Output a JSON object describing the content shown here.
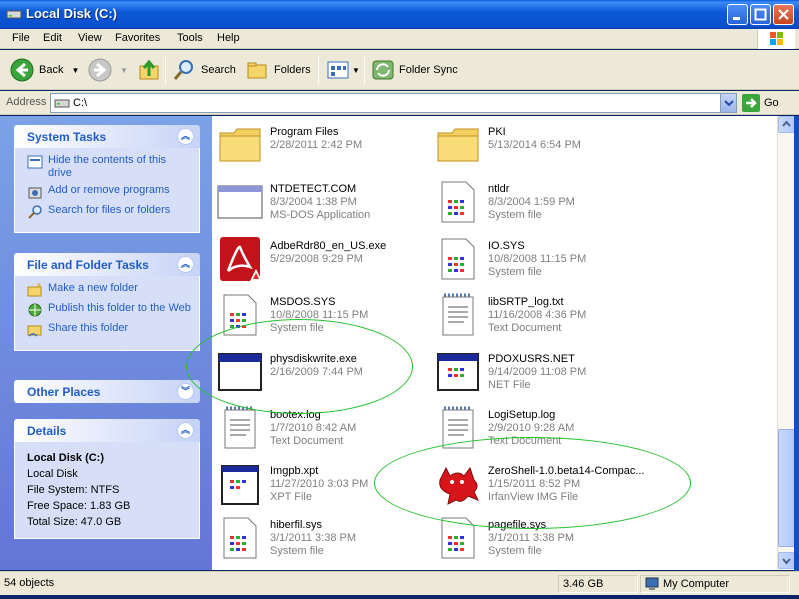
{
  "window": {
    "title": "Local Disk (C:)"
  },
  "menu": [
    "File",
    "Edit",
    "View",
    "Favorites",
    "Tools",
    "Help"
  ],
  "toolbar": {
    "back": "Back",
    "search": "Search",
    "folders": "Folders",
    "folder_sync": "Folder Sync"
  },
  "address": {
    "label": "Address",
    "value": "C:\\",
    "go": "Go"
  },
  "system_tasks": {
    "title": "System Tasks",
    "items": [
      "Hide the contents of this drive",
      "Add or remove programs",
      "Search for files or folders"
    ]
  },
  "file_folder_tasks": {
    "title": "File and Folder Tasks",
    "items": [
      "Make a new folder",
      "Publish this folder to the Web",
      "Share this folder"
    ]
  },
  "other_places": {
    "title": "Other Places"
  },
  "details": {
    "title": "Details",
    "name": "Local Disk (C:)",
    "type": "Local Disk",
    "filesystem": "File System: NTFS",
    "free": "Free Space: 1.83 GB",
    "total": "Total Size: 47.0 GB"
  },
  "files": [
    {
      "name": "Program Files",
      "line2": "2/28/2011 2:42 PM",
      "line3": "",
      "icon": "folder-icon"
    },
    {
      "name": "PKI",
      "line2": "5/13/2014 6:54 PM",
      "line3": "",
      "icon": "folder-icon"
    },
    {
      "name": "NTDETECT.COM",
      "line2": "8/3/2004 1:38 PM",
      "line3": "MS-DOS Application",
      "icon": "app-window-icon"
    },
    {
      "name": "ntldr",
      "line2": "8/3/2004 1:59 PM",
      "line3": "System file",
      "icon": "system-file-icon"
    },
    {
      "name": "AdbeRdr80_en_US.exe",
      "line2": "5/29/2008 9:29 PM",
      "line3": "",
      "icon": "adobe-reader-icon"
    },
    {
      "name": "IO.SYS",
      "line2": "10/8/2008 11:15 PM",
      "line3": "System file",
      "icon": "system-file-icon"
    },
    {
      "name": "MSDOS.SYS",
      "line2": "10/8/2008 11:15 PM",
      "line3": "System file",
      "icon": "system-file-icon"
    },
    {
      "name": "libSRTP_log.txt",
      "line2": "11/16/2008 4:36 PM",
      "line3": "Text Document",
      "icon": "text-document-icon"
    },
    {
      "name": "physdiskwrite.exe",
      "line2": "2/16/2009 7:44 PM",
      "line3": "",
      "icon": "exe-window-icon"
    },
    {
      "name": "PDOXUSRS.NET",
      "line2": "9/14/2009 11:08 PM",
      "line3": "NET File",
      "icon": "net-file-icon"
    },
    {
      "name": "bootex.log",
      "line2": "1/7/2010 8:42 AM",
      "line3": "Text Document",
      "icon": "text-document-icon"
    },
    {
      "name": "LogiSetup.log",
      "line2": "2/9/2010 9:28 AM",
      "line3": "Text Document",
      "icon": "text-document-icon"
    },
    {
      "name": "Imgpb.xpt",
      "line2": "11/27/2010 3:03 PM",
      "line3": "XPT File",
      "icon": "xpt-file-icon"
    },
    {
      "name": "ZeroShell-1.0.beta14-Compac...",
      "line2": "1/15/2011 8:52 PM",
      "line3": "IrfanView IMG File",
      "icon": "irfanview-cat-icon"
    },
    {
      "name": "hiberfil.sys",
      "line2": "3/1/2011 3:38 PM",
      "line3": "System file",
      "icon": "system-file-icon"
    },
    {
      "name": "pagefile.sys",
      "line2": "3/1/2011 3:38 PM",
      "line3": "System file",
      "icon": "system-file-icon"
    }
  ],
  "status": {
    "objects": "54 objects",
    "size": "3.46 GB",
    "location": "My Computer"
  }
}
